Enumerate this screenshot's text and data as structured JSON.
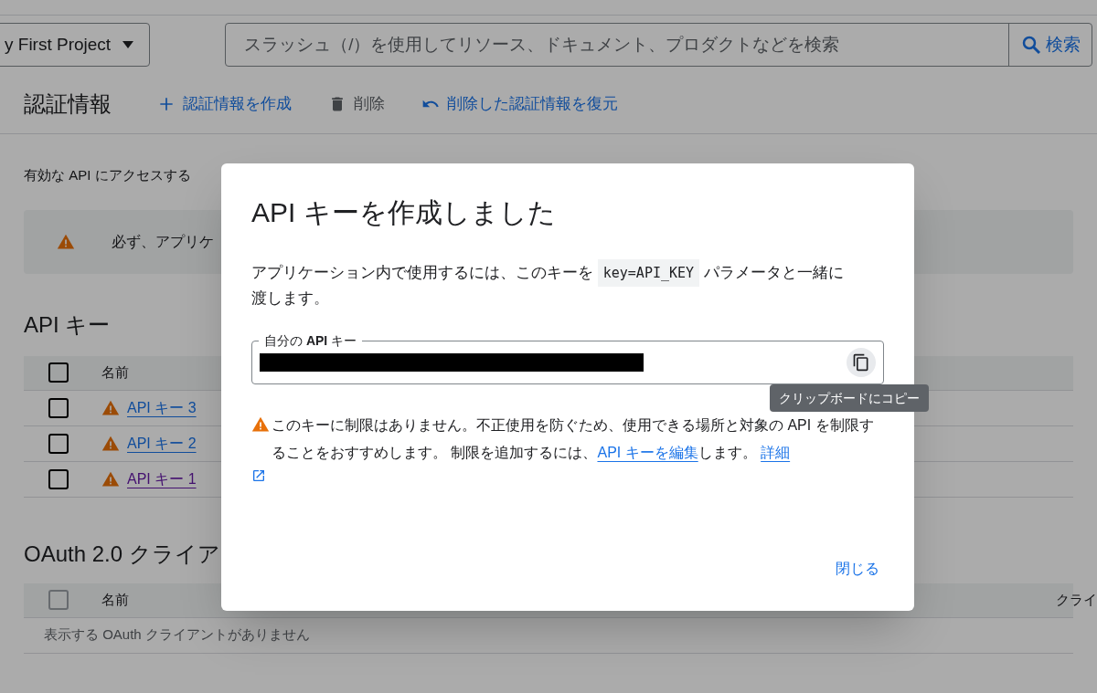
{
  "header": {
    "project": "y First Project",
    "search": {
      "placeholder": "スラッシュ（/）を使用してリソース、ドキュメント、プロダクトなどを検索"
    },
    "search_button": "検索"
  },
  "toolbar": {
    "title": "認証情報",
    "actions": [
      {
        "kind": "add",
        "label": "認証情報を作成"
      },
      {
        "kind": "delete",
        "label": "削除"
      },
      {
        "kind": "undo",
        "label": "削除した認証情報を復元"
      }
    ]
  },
  "intro": "有効な API にアクセスする",
  "banner": "必ず、アプリケ",
  "api_keys": {
    "title": "API キー",
    "header": "名前",
    "header_checked": false,
    "rows": [
      {
        "name": "API キー 3",
        "checked": false,
        "visited": false
      },
      {
        "name": "API キー 2",
        "checked": false,
        "visited": false
      },
      {
        "name": "API キー 1",
        "checked": false,
        "visited": true
      }
    ]
  },
  "oauth": {
    "title": "OAuth 2.0 クライア",
    "header_checked": false,
    "header_disabled": true,
    "columns": [
      "名前",
      "クライ"
    ],
    "empty": "表示する OAuth クライアントがありません"
  },
  "dialog": {
    "title": "API キーを作成しました",
    "desc_before": "アプリケーション内で使用するには、このキーを",
    "code": "key=API_KEY",
    "desc_after": "パラメータと一緒に渡します。",
    "field_label": "自分の **API** キー",
    "tooltip": "クリップボードにコピー",
    "warning": "このキーに制限はありません。不正使用を防ぐため、使用できる場所と対象の API を制限することをおすすめします。 制限を追加するには、",
    "edit_link": "API キーを編集",
    "warning_after": "します。",
    "details_link": "詳細",
    "close": "閉じる"
  }
}
